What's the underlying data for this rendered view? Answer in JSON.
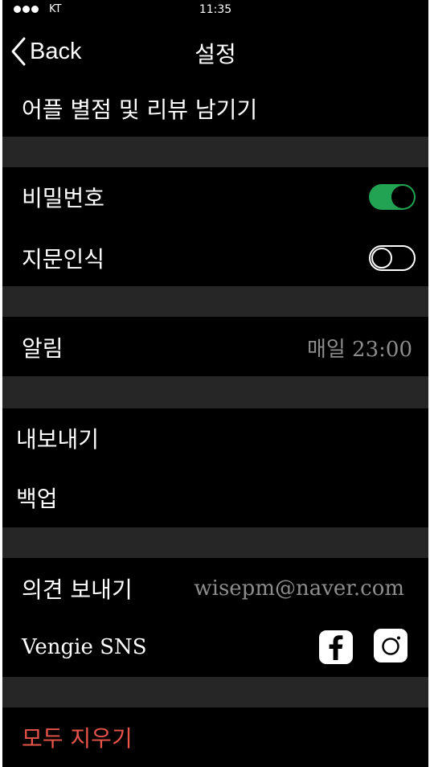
{
  "status_bar": {
    "carrier": "KT",
    "time": "11:35"
  },
  "nav": {
    "back_label": "Back",
    "title": "설정"
  },
  "rate_review": "어플 별점 및 리뷰 남기기",
  "security": {
    "password": {
      "label": "비밀번호",
      "enabled": true
    },
    "fingerprint": {
      "label": "지문인식",
      "enabled": false
    }
  },
  "notification": {
    "label": "알림",
    "value": "매일 23:00"
  },
  "data": {
    "export_label": "내보내기",
    "backup_label": "백업"
  },
  "feedback": {
    "label": "의견 보내기",
    "email": "wisepm@naver.com"
  },
  "sns": {
    "label": "Vengie SNS",
    "icons": [
      "facebook-icon",
      "instagram-icon"
    ]
  },
  "reset": {
    "label": "모두 지우기"
  },
  "colors": {
    "toggle_on": "#21a353",
    "danger": "#e8534a",
    "separator": "#262626",
    "value_text": "#8d8d8d"
  }
}
